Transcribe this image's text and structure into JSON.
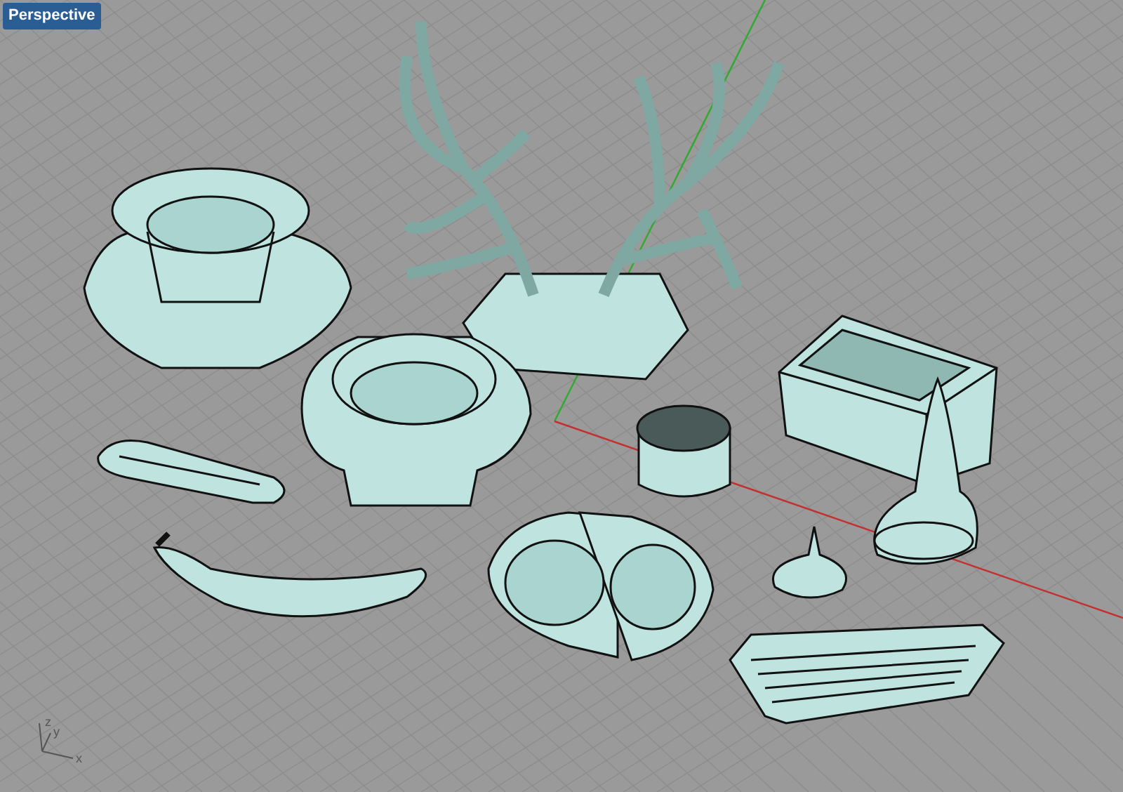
{
  "viewport": {
    "label": "Perspective",
    "axis_labels": [
      "z",
      "y",
      "x"
    ]
  }
}
